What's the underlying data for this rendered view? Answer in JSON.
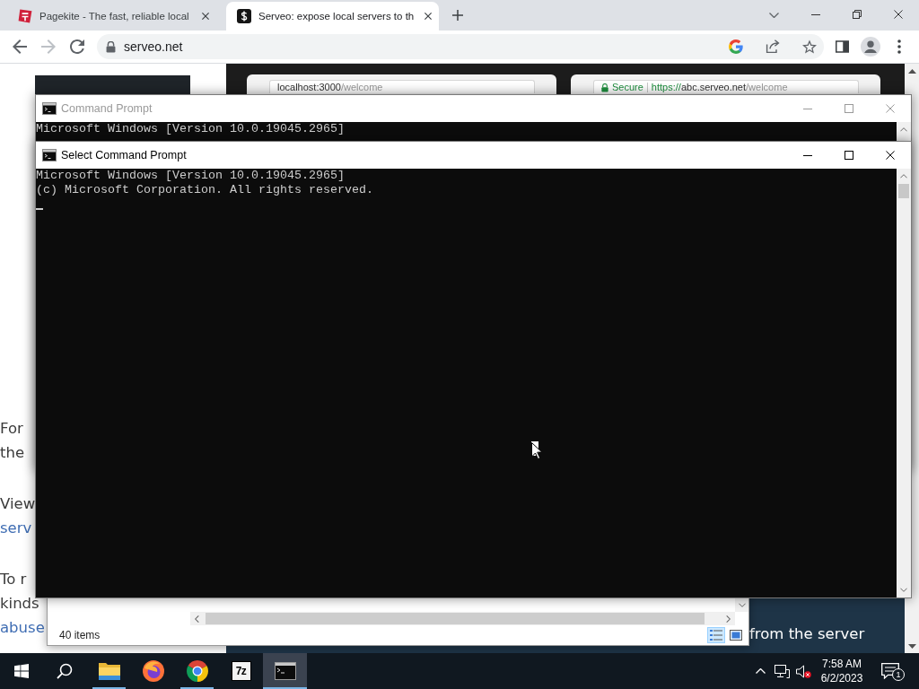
{
  "browser": {
    "tabs": [
      {
        "title": "Pagekite - The fast, reliable local",
        "selected": false
      },
      {
        "title": "Serveo: expose local servers to th",
        "selected": true
      }
    ],
    "nav": [
      {
        "kind": "back",
        "disabled": false
      },
      {
        "kind": "forward",
        "disabled": true
      },
      {
        "kind": "reload",
        "disabled": false
      }
    ],
    "address": {
      "secure": true,
      "url": "serveo.net"
    },
    "page": {
      "screenshots": [
        {
          "secure": false,
          "host": "localhost:3000",
          "path": "/welcome"
        },
        {
          "secure": true,
          "secure_label": "Secure",
          "scheme": "https://",
          "host": "abc.serveo.net",
          "path": "/welcome"
        }
      ],
      "paragraphs": [
        {
          "lines": [
            {
              "text": "For",
              "link": false
            },
            {
              "text": "the",
              "link": false
            }
          ]
        },
        {
          "lines": [
            {
              "text": "View",
              "link": false
            },
            {
              "text": "serv",
              "link": true
            }
          ]
        },
        {
          "lines": [
            {
              "text": "To r",
              "link": false
            },
            {
              "text": "kinds",
              "link": false
            },
            {
              "text": "abuse",
              "link": true
            }
          ]
        }
      ],
      "banner_lines": [
        "from the server"
      ]
    }
  },
  "explorer": {
    "status": "40 items",
    "views": [
      {
        "kind": "details",
        "selected": true
      },
      {
        "kind": "large-icons",
        "selected": false
      }
    ]
  },
  "consoles": [
    {
      "title": "Command Prompt",
      "active": false,
      "lines": [
        "Microsoft Windows [Version 10.0.19045.2965]"
      ]
    },
    {
      "title": "Select Command Prompt",
      "active": true,
      "lines": [
        "Microsoft Windows [Version 10.0.19045.2965]",
        "(c) Microsoft Corporation. All rights reserved."
      ],
      "cursor": true,
      "selection": true
    }
  ],
  "taskbar": {
    "apps": [
      {
        "kind": "file-explorer",
        "open": true,
        "active": false
      },
      {
        "kind": "firefox",
        "open": false,
        "active": false
      },
      {
        "kind": "chrome",
        "open": true,
        "active": false
      },
      {
        "kind": "archiver",
        "label": "7z",
        "open": false,
        "active": false
      },
      {
        "kind": "terminal",
        "open": true,
        "active": true
      }
    ],
    "volume": {
      "muted": true
    },
    "clock": {
      "time": "7:58 AM",
      "date": "6/2/2023"
    },
    "notifications": "1"
  }
}
